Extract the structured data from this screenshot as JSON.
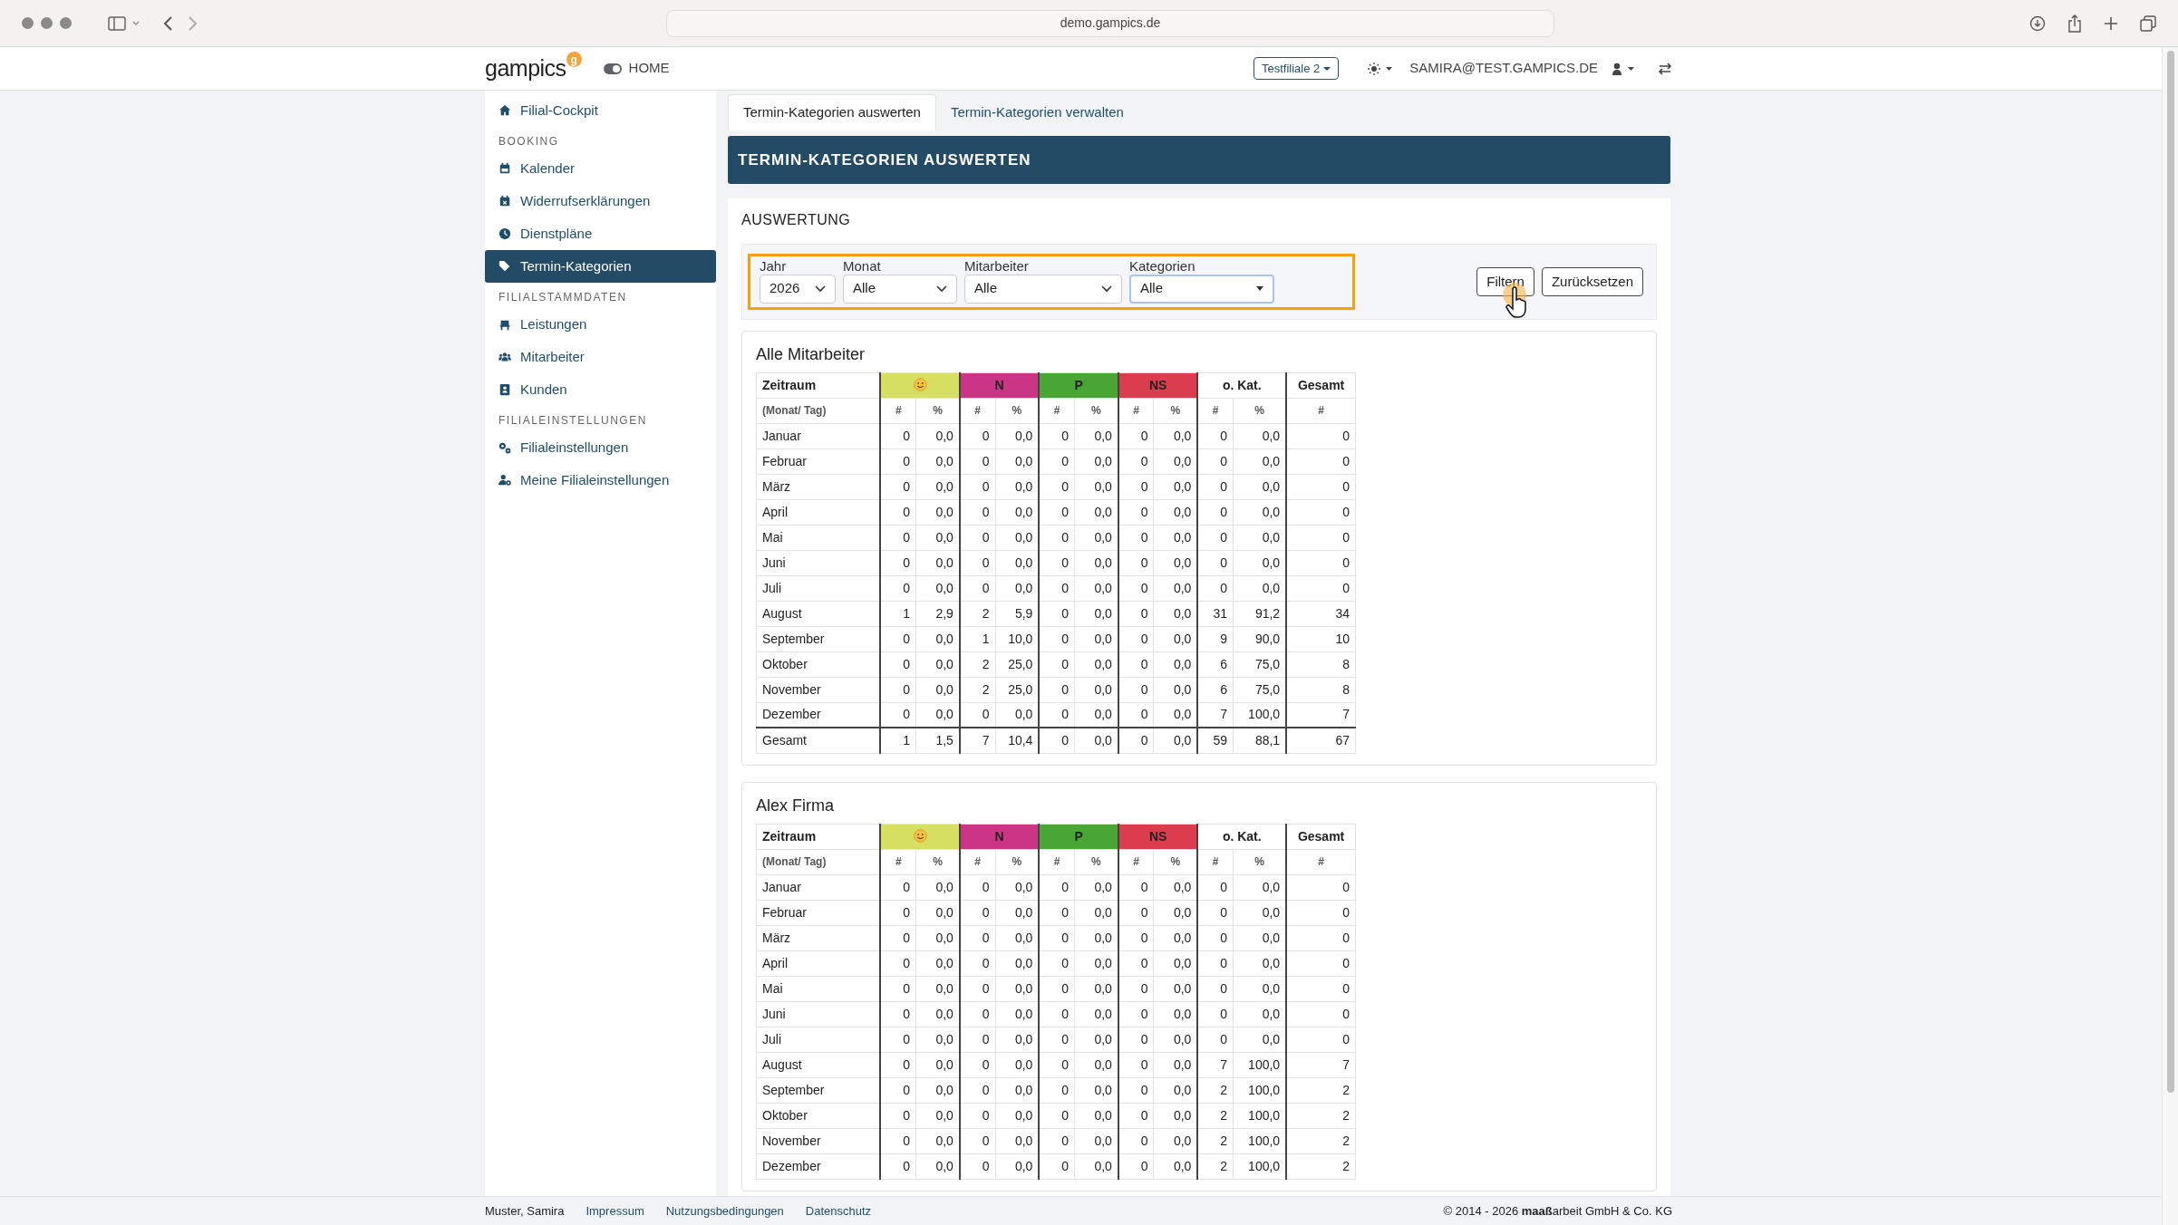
{
  "browser": {
    "url": "demo.gampics.de"
  },
  "navbar": {
    "brand": "gampics",
    "brand_badge": "g",
    "home": "HOME",
    "branch": "Testfiliale 2",
    "user": "SAMIRA@TEST.GAMPICS.DE"
  },
  "sidebar": {
    "items": [
      {
        "kind": "link",
        "label": "Filial-Cockpit",
        "selected": false
      },
      {
        "kind": "section",
        "label": "BOOKING"
      },
      {
        "kind": "link",
        "label": "Kalender",
        "selected": false
      },
      {
        "kind": "link",
        "label": "Widerrufserklärungen",
        "selected": false
      },
      {
        "kind": "link",
        "label": "Dienstpläne",
        "selected": false
      },
      {
        "kind": "link",
        "label": "Termin-Kategorien",
        "selected": true
      },
      {
        "kind": "section",
        "label": "FILIALSTAMMDATEN"
      },
      {
        "kind": "link",
        "label": "Leistungen",
        "selected": false
      },
      {
        "kind": "link",
        "label": "Mitarbeiter",
        "selected": false
      },
      {
        "kind": "link",
        "label": "Kunden",
        "selected": false
      },
      {
        "kind": "section",
        "label": "FILIALEINSTELLUNGEN"
      },
      {
        "kind": "link",
        "label": "Filialeinstellungen",
        "selected": false
      },
      {
        "kind": "link",
        "label": "Meine Filialeinstellungen",
        "selected": false
      }
    ]
  },
  "tabs": [
    {
      "label": "Termin-Kategorien auswerten",
      "selected": true
    },
    {
      "label": "Termin-Kategorien verwalten",
      "selected": false
    }
  ],
  "page_title": "TERMIN-KATEGORIEN AUSWERTEN",
  "section_title": "AUSWERTUNG",
  "filters": [
    {
      "label": "Jahr",
      "value": "2026"
    },
    {
      "label": "Monat",
      "value": "Alle"
    },
    {
      "label": "Mitarbeiter",
      "value": "Alle"
    },
    {
      "label": "Kategorien",
      "value": "Alle",
      "focused": true
    }
  ],
  "buttons": [
    "Filtern",
    "Zurücksetzen"
  ],
  "tables": [
    {
      "title": "Alle Mitarbeiter",
      "columns": [
        {
          "kind": "text",
          "label": "Zeitraum"
        },
        {
          "kind": "icon",
          "color": "#d8e064"
        },
        {
          "kind": "text",
          "label": "N",
          "color": "#cc3486"
        },
        {
          "kind": "text",
          "label": "P",
          "color": "#4aa634"
        },
        {
          "kind": "text",
          "label": "NS",
          "color": "#dc3d4e"
        },
        {
          "kind": "text",
          "label": "o. Kat."
        },
        {
          "kind": "text",
          "label": "Gesamt"
        }
      ],
      "subheaders": [
        "(Monat/ Tag)",
        "#",
        "%",
        "#",
        "%",
        "#",
        "%",
        "#",
        "%",
        "#",
        "%",
        "#"
      ],
      "rows": [
        {
          "label": "Januar",
          "values": [
            "0",
            "0,0",
            "0",
            "0,0",
            "0",
            "0,0",
            "0",
            "0,0",
            "0",
            "0,0",
            "0"
          ]
        },
        {
          "label": "Februar",
          "values": [
            "0",
            "0,0",
            "0",
            "0,0",
            "0",
            "0,0",
            "0",
            "0,0",
            "0",
            "0,0",
            "0"
          ]
        },
        {
          "label": "März",
          "values": [
            "0",
            "0,0",
            "0",
            "0,0",
            "0",
            "0,0",
            "0",
            "0,0",
            "0",
            "0,0",
            "0"
          ]
        },
        {
          "label": "April",
          "values": [
            "0",
            "0,0",
            "0",
            "0,0",
            "0",
            "0,0",
            "0",
            "0,0",
            "0",
            "0,0",
            "0"
          ]
        },
        {
          "label": "Mai",
          "values": [
            "0",
            "0,0",
            "0",
            "0,0",
            "0",
            "0,0",
            "0",
            "0,0",
            "0",
            "0,0",
            "0"
          ]
        },
        {
          "label": "Juni",
          "values": [
            "0",
            "0,0",
            "0",
            "0,0",
            "0",
            "0,0",
            "0",
            "0,0",
            "0",
            "0,0",
            "0"
          ]
        },
        {
          "label": "Juli",
          "values": [
            "0",
            "0,0",
            "0",
            "0,0",
            "0",
            "0,0",
            "0",
            "0,0",
            "0",
            "0,0",
            "0"
          ]
        },
        {
          "label": "August",
          "values": [
            "1",
            "2,9",
            "2",
            "5,9",
            "0",
            "0,0",
            "0",
            "0,0",
            "31",
            "91,2",
            "34"
          ]
        },
        {
          "label": "September",
          "values": [
            "0",
            "0,0",
            "1",
            "10,0",
            "0",
            "0,0",
            "0",
            "0,0",
            "9",
            "90,0",
            "10"
          ]
        },
        {
          "label": "Oktober",
          "values": [
            "0",
            "0,0",
            "2",
            "25,0",
            "0",
            "0,0",
            "0",
            "0,0",
            "6",
            "75,0",
            "8"
          ]
        },
        {
          "label": "November",
          "values": [
            "0",
            "0,0",
            "2",
            "25,0",
            "0",
            "0,0",
            "0",
            "0,0",
            "6",
            "75,0",
            "8"
          ]
        },
        {
          "label": "Dezember",
          "values": [
            "0",
            "0,0",
            "0",
            "0,0",
            "0",
            "0,0",
            "0",
            "0,0",
            "7",
            "100,0",
            "7"
          ]
        }
      ],
      "total": {
        "label": "Gesamt",
        "values": [
          "1",
          "1,5",
          "7",
          "10,4",
          "0",
          "0,0",
          "0",
          "0,0",
          "59",
          "88,1",
          "67"
        ]
      }
    },
    {
      "title": "Alex Firma",
      "columns": [
        {
          "kind": "text",
          "label": "Zeitraum"
        },
        {
          "kind": "icon",
          "color": "#d8e064"
        },
        {
          "kind": "text",
          "label": "N",
          "color": "#cc3486"
        },
        {
          "kind": "text",
          "label": "P",
          "color": "#4aa634"
        },
        {
          "kind": "text",
          "label": "NS",
          "color": "#dc3d4e"
        },
        {
          "kind": "text",
          "label": "o. Kat."
        },
        {
          "kind": "text",
          "label": "Gesamt"
        }
      ],
      "subheaders": [
        "(Monat/ Tag)",
        "#",
        "%",
        "#",
        "%",
        "#",
        "%",
        "#",
        "%",
        "#",
        "%",
        "#"
      ],
      "rows": [
        {
          "label": "Januar",
          "values": [
            "0",
            "0,0",
            "0",
            "0,0",
            "0",
            "0,0",
            "0",
            "0,0",
            "0",
            "0,0",
            "0"
          ]
        },
        {
          "label": "Februar",
          "values": [
            "0",
            "0,0",
            "0",
            "0,0",
            "0",
            "0,0",
            "0",
            "0,0",
            "0",
            "0,0",
            "0"
          ]
        },
        {
          "label": "März",
          "values": [
            "0",
            "0,0",
            "0",
            "0,0",
            "0",
            "0,0",
            "0",
            "0,0",
            "0",
            "0,0",
            "0"
          ]
        },
        {
          "label": "April",
          "values": [
            "0",
            "0,0",
            "0",
            "0,0",
            "0",
            "0,0",
            "0",
            "0,0",
            "0",
            "0,0",
            "0"
          ]
        },
        {
          "label": "Mai",
          "values": [
            "0",
            "0,0",
            "0",
            "0,0",
            "0",
            "0,0",
            "0",
            "0,0",
            "0",
            "0,0",
            "0"
          ]
        },
        {
          "label": "Juni",
          "values": [
            "0",
            "0,0",
            "0",
            "0,0",
            "0",
            "0,0",
            "0",
            "0,0",
            "0",
            "0,0",
            "0"
          ]
        },
        {
          "label": "Juli",
          "values": [
            "0",
            "0,0",
            "0",
            "0,0",
            "0",
            "0,0",
            "0",
            "0,0",
            "0",
            "0,0",
            "0"
          ]
        },
        {
          "label": "August",
          "values": [
            "0",
            "0,0",
            "0",
            "0,0",
            "0",
            "0,0",
            "0",
            "0,0",
            "7",
            "100,0",
            "7"
          ]
        },
        {
          "label": "September",
          "values": [
            "0",
            "0,0",
            "0",
            "0,0",
            "0",
            "0,0",
            "0",
            "0,0",
            "2",
            "100,0",
            "2"
          ]
        },
        {
          "label": "Oktober",
          "values": [
            "0",
            "0,0",
            "0",
            "0,0",
            "0",
            "0,0",
            "0",
            "0,0",
            "2",
            "100,0",
            "2"
          ]
        },
        {
          "label": "November",
          "values": [
            "0",
            "0,0",
            "0",
            "0,0",
            "0",
            "0,0",
            "0",
            "0,0",
            "2",
            "100,0",
            "2"
          ]
        },
        {
          "label": "Dezember",
          "values": [
            "0",
            "0,0",
            "0",
            "0,0",
            "0",
            "0,0",
            "0",
            "0,0",
            "2",
            "100,0",
            "2"
          ]
        }
      ]
    }
  ],
  "footer": {
    "user": "Muster, Samira",
    "links": [
      "Impressum",
      "Nutzungsbedingungen",
      "Datenschutz"
    ],
    "copyright": "© 2014 - 2026 **maaß**arbeit GmbH & Co. KG"
  }
}
